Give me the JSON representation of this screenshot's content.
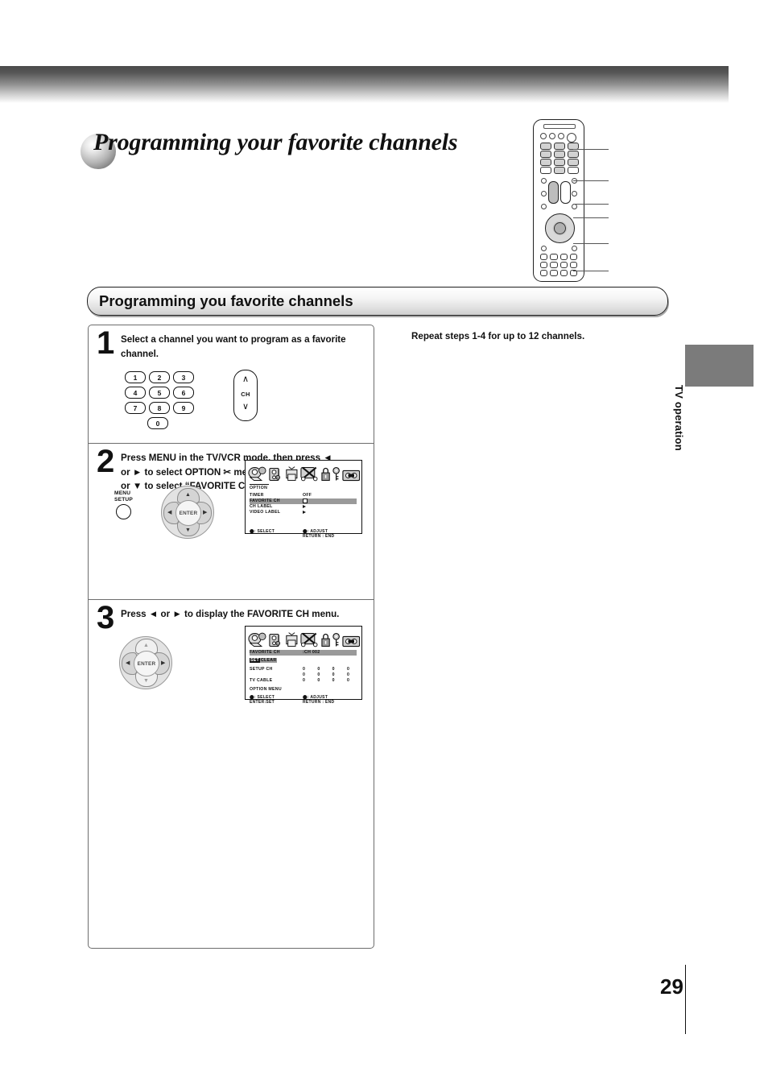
{
  "document": {
    "title": "Programming your favorite channels",
    "section_heading": "Programming you favorite channels",
    "page_number": "29",
    "sidebar_label": "TV operation",
    "note": "Repeat steps 1-4 for up to 12 channels."
  },
  "steps": [
    {
      "number": "1",
      "text": "Select a channel you want to program as a favorite channel.",
      "keypad": [
        "1",
        "2",
        "3",
        "4",
        "5",
        "6",
        "7",
        "8",
        "9",
        "0"
      ],
      "ch_button_label": "CH",
      "ch_up": "∧",
      "ch_down": "∨"
    },
    {
      "number": "2",
      "text_parts": {
        "line1": "Press MENU in the TV/VCR mode, then press ◄",
        "line2": "or ► to select OPTION ✂ menu, then press ▲",
        "line3": "or ▼ to select “FAVORITE CH”."
      },
      "menu_button_label_line1": "MENU",
      "menu_button_label_line2": "SETUP",
      "enter_label": "ENTER"
    },
    {
      "number": "3",
      "text": "Press ◄ or ► to display the FAVORITE CH menu.",
      "enter_label": "ENTER"
    }
  ],
  "osd_option": {
    "menu_name": "OPTION",
    "rows": [
      {
        "label": "TIMER",
        "value": "OFF",
        "highlighted": false
      },
      {
        "label": "FAVORITE CH",
        "value": "",
        "highlighted": true
      },
      {
        "label": "CH LABEL",
        "value": "",
        "highlighted": false
      },
      {
        "label": "VIDEO LABEL",
        "value": "",
        "highlighted": false
      }
    ],
    "footer_left": "⬤: SELECT",
    "footer_right_line1": "⬤: ADJUST",
    "footer_right_line2": "RETURN : END"
  },
  "osd_favorite": {
    "title_label": "FAVORITE CH",
    "title_value": ":CH 002",
    "set_label": "SET",
    "clear_label": "CLEAR",
    "rows": [
      {
        "label": "SETUP CH",
        "cells": "0  0  0  0"
      },
      {
        "label": "",
        "cells": "0  0  0  0"
      },
      {
        "label": "TV CABLE",
        "cells": "0  0  0  0"
      },
      {
        "label": "OPTION MENU",
        "cells": ""
      }
    ],
    "footer_left_line1": "⬤: SELECT",
    "footer_left_line2": "ENTER:SET",
    "footer_right_line1": "⬤: ADJUST",
    "footer_right_line2": "RETURN : END"
  }
}
